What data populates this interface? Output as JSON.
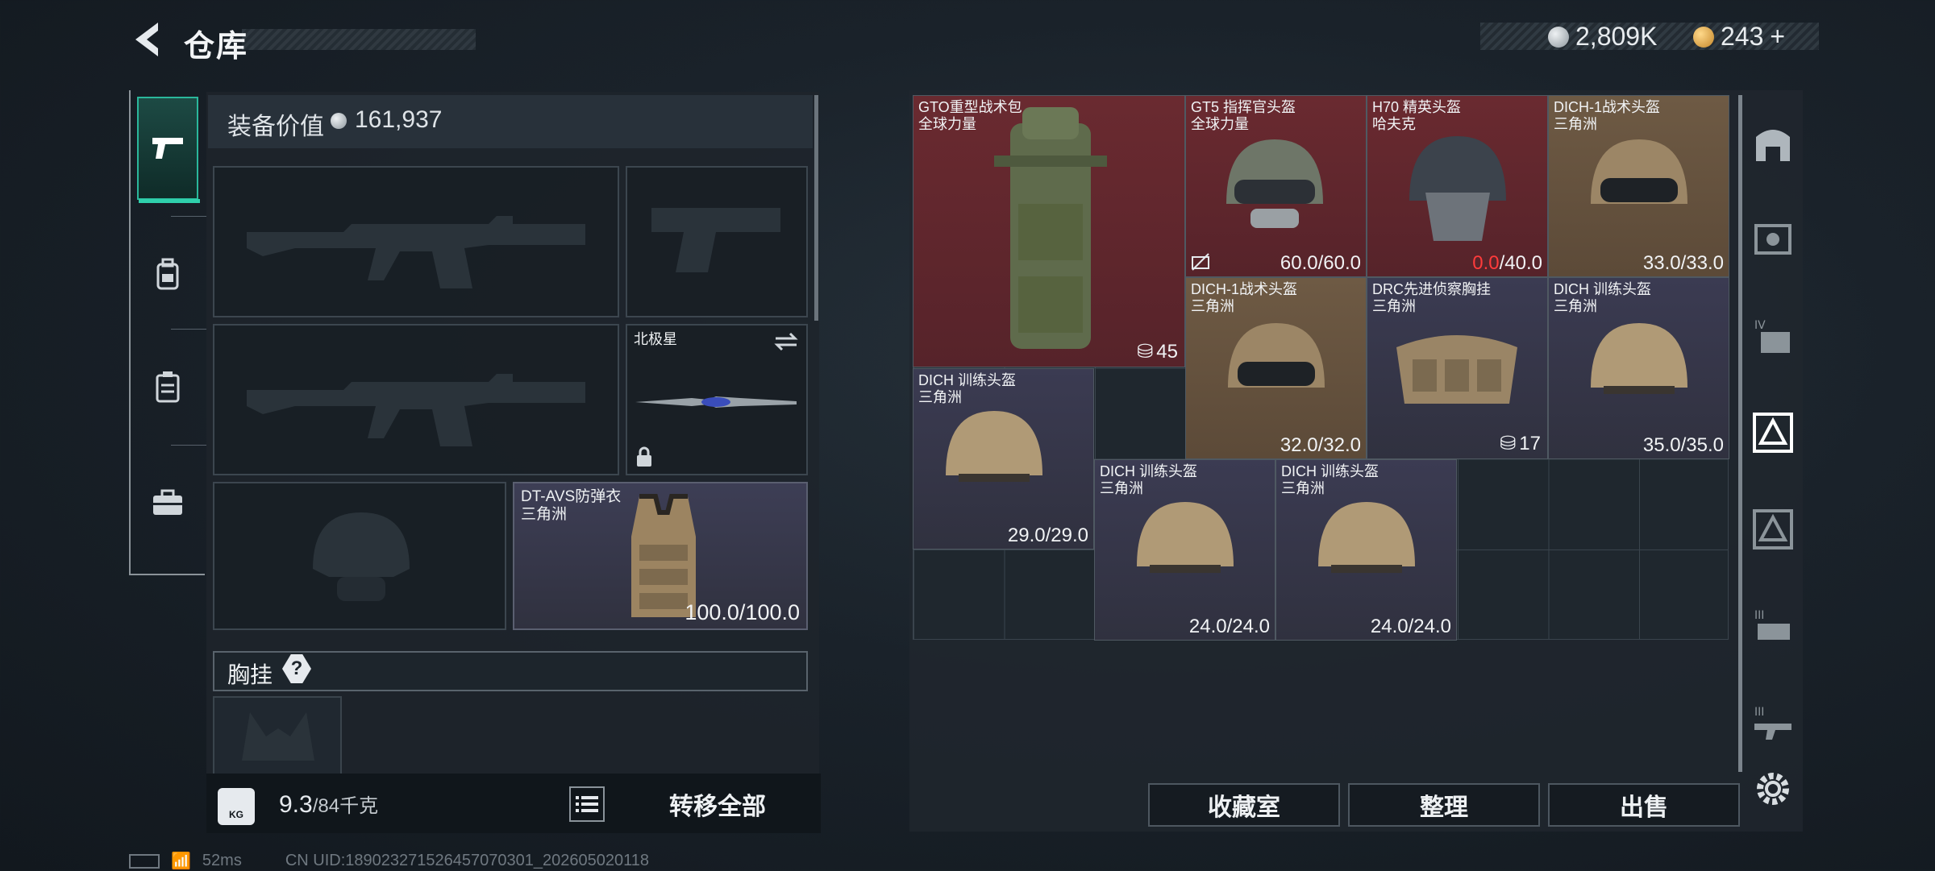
{
  "header": {
    "title": "仓库",
    "currency_silver": "2,809K",
    "currency_gold": "243",
    "add_symbol": "+",
    "silver_color": "#bfc6cc",
    "gold_color": "#e0a94a"
  },
  "equipment": {
    "value_label": "装备价值",
    "value": "161,937",
    "melee_name": "北极星",
    "armor_name": "DT-AVS防弹衣",
    "armor_maker": "三角洲",
    "armor_durability": "100.0/100.0",
    "chest_label": "胸挂",
    "chest_help": "?",
    "weight_value": "9.3",
    "weight_max": "/84千克",
    "kg_label": "KG",
    "transfer_all": "转移全部"
  },
  "tabs": [
    "pistol-icon",
    "backpack-icon",
    "locker-icon",
    "toolbox-icon"
  ],
  "inventory": {
    "items": [
      {
        "name": "GTO重型战术包",
        "maker": "全球力量",
        "count": "45",
        "rarity": "red"
      },
      {
        "name": "GT5 指挥官头盔",
        "maker": "全球力量",
        "dur": "60.0/60.0",
        "rarity": "red"
      },
      {
        "name": "H70 精英头盔",
        "maker": "哈夫克",
        "dur_now": "0.0",
        "dur_max": "/40.0",
        "rarity": "red"
      },
      {
        "name": "DICH-1战术头盔",
        "maker": "三角洲",
        "dur": "33.0/33.0",
        "rarity": "gold"
      },
      {
        "name": "DICH-1战术头盔",
        "maker": "三角洲",
        "dur": "32.0/32.0",
        "rarity": "gold"
      },
      {
        "name": "DRC先进侦察胸挂",
        "maker": "三角洲",
        "count": "17",
        "rarity": "purple"
      },
      {
        "name": "DICH 训练头盔",
        "maker": "三角洲",
        "dur": "35.0/35.0",
        "rarity": "purple"
      },
      {
        "name": "DICH 训练头盔",
        "maker": "三角洲",
        "dur": "29.0/29.0",
        "rarity": "purple"
      },
      {
        "name": "DICH 训练头盔",
        "maker": "三角洲",
        "dur": "24.0/24.0",
        "rarity": "purple"
      },
      {
        "name": "DICH 训练头盔",
        "maker": "三角洲",
        "dur": "24.0/24.0",
        "rarity": "purple"
      }
    ]
  },
  "buttons": {
    "collection": "收藏室",
    "sort": "整理",
    "sell": "出售"
  },
  "status": {
    "ping": "52ms",
    "uid": "CN UID:18902327152645707030​1_202605020118"
  }
}
